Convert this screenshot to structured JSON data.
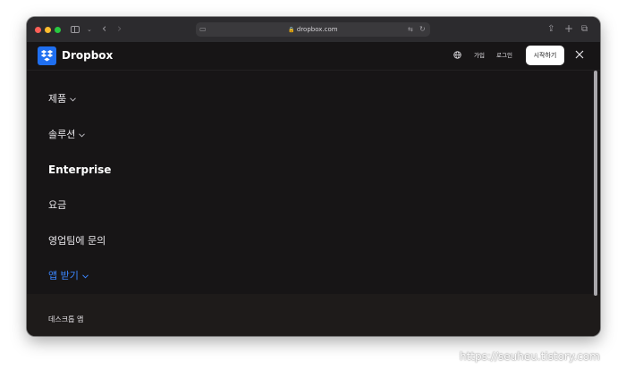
{
  "browser": {
    "url": "dropbox.com"
  },
  "header": {
    "brand": "Dropbox",
    "signup": "가입",
    "login": "로그인",
    "start": "시작하기"
  },
  "menu": {
    "items": [
      {
        "label": "제품"
      },
      {
        "label": "솔루션"
      },
      {
        "label": "Enterprise"
      },
      {
        "label": "요금"
      },
      {
        "label": "영업팀에 문의"
      },
      {
        "label": "앱 받기"
      }
    ],
    "sub_items": [
      {
        "label": "데스크톱 앱"
      }
    ]
  },
  "colors": {
    "accent": "#3b86ff",
    "logo": "#1f6ff0"
  },
  "watermark": "https://seuheu.tistory.com"
}
